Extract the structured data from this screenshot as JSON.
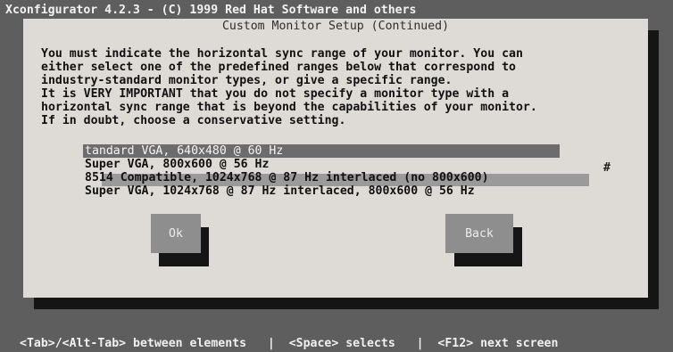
{
  "window": {
    "title": "Xconfigurator 4.2.3 - (C) 1999 Red Hat Software and others"
  },
  "dialog": {
    "title": "Custom Monitor Setup (Continued)",
    "instructions": "You must indicate the horizontal sync range of your monitor. You can\neither select one of the predefined ranges below that correspond to\nindustry-standard monitor types, or give a specific range.\nIt is VERY IMPORTANT that you do not specify a monitor type with a\nhorizontal sync range that is beyond the capabilities of your monitor.\nIf in doubt, choose a conservative setting.",
    "monitor_list": {
      "items": [
        "tandard VGA, 640x480 @ 60 Hz",
        "Super VGA, 800x600 @ 56 Hz",
        "8514 Compatible, 1024x768 @ 87 Hz interlaced (no 800x600)",
        "Super VGA, 1024x768 @ 87 Hz interlaced, 800x600 @ 56 Hz"
      ],
      "selected_index": 0,
      "scroll_marker": "#"
    },
    "buttons": {
      "ok_label": "Ok",
      "back_label": "Back"
    }
  },
  "status_bar": {
    "text": "<Tab>/<Alt-Tab> between elements   |  <Space> selects   |  <F12> next screen"
  },
  "colors": {
    "screen_background": "#5e5e5e",
    "dialog_background": "#dedbd6",
    "selection_highlight": "#6c6c6c",
    "button_face": "#8e8e8e",
    "shadow": "#151515"
  }
}
